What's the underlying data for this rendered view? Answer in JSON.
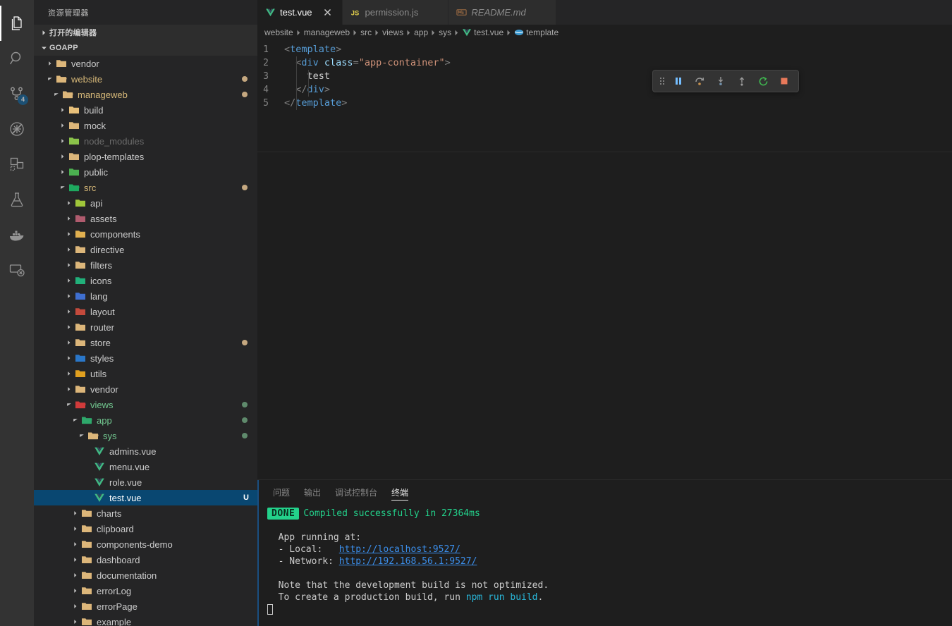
{
  "activitybar": {
    "items": [
      {
        "name": "explorer",
        "icon": "files-icon",
        "active": true,
        "badge": null
      },
      {
        "name": "search",
        "icon": "search-icon",
        "active": false,
        "badge": null
      },
      {
        "name": "source-control",
        "icon": "source-control-icon",
        "active": false,
        "badge": "4"
      },
      {
        "name": "run-debug",
        "icon": "debug-alt-icon",
        "active": false,
        "badge": null
      },
      {
        "name": "extensions",
        "icon": "extensions-icon",
        "active": false,
        "badge": null
      },
      {
        "name": "testing",
        "icon": "beaker-icon",
        "active": false,
        "badge": null
      },
      {
        "name": "docker",
        "icon": "docker-whale-icon",
        "active": false,
        "badge": null
      },
      {
        "name": "remote-explorer",
        "icon": "remote-explorer-icon",
        "active": false,
        "badge": null
      }
    ]
  },
  "sidebar": {
    "title": "资源管理器",
    "sections": [
      {
        "label": "打开的编辑器",
        "expanded": false
      },
      {
        "label": "GOAPP",
        "expanded": true
      }
    ],
    "tree": [
      {
        "label": "vendor",
        "icon": "folder",
        "indent": 1,
        "twisty": "collapsed",
        "state": "normal",
        "deco": null
      },
      {
        "label": "website",
        "icon": "folder-open",
        "indent": 1,
        "twisty": "expanded",
        "state": "modified",
        "deco": "tan"
      },
      {
        "label": "manageweb",
        "icon": "folder-open",
        "indent": 2,
        "twisty": "expanded",
        "state": "modified",
        "deco": "tan"
      },
      {
        "label": "build",
        "icon": "folder-build",
        "indent": 3,
        "twisty": "collapsed",
        "state": "normal",
        "deco": null
      },
      {
        "label": "mock",
        "icon": "folder",
        "indent": 3,
        "twisty": "collapsed",
        "state": "normal",
        "deco": null
      },
      {
        "label": "node_modules",
        "icon": "folder-node",
        "indent": 3,
        "twisty": "collapsed",
        "state": "dim",
        "deco": null
      },
      {
        "label": "plop-templates",
        "icon": "folder",
        "indent": 3,
        "twisty": "collapsed",
        "state": "normal",
        "deco": null
      },
      {
        "label": "public",
        "icon": "folder-public",
        "indent": 3,
        "twisty": "collapsed",
        "state": "normal",
        "deco": null
      },
      {
        "label": "src",
        "icon": "folder-src",
        "indent": 3,
        "twisty": "expanded",
        "state": "modified",
        "deco": "tan"
      },
      {
        "label": "api",
        "icon": "folder-api",
        "indent": 4,
        "twisty": "collapsed",
        "state": "normal",
        "deco": null
      },
      {
        "label": "assets",
        "icon": "folder-assets",
        "indent": 4,
        "twisty": "collapsed",
        "state": "normal",
        "deco": null
      },
      {
        "label": "components",
        "icon": "folder-components",
        "indent": 4,
        "twisty": "collapsed",
        "state": "normal",
        "deco": null
      },
      {
        "label": "directive",
        "icon": "folder",
        "indent": 4,
        "twisty": "collapsed",
        "state": "normal",
        "deco": null
      },
      {
        "label": "filters",
        "icon": "folder",
        "indent": 4,
        "twisty": "collapsed",
        "state": "normal",
        "deco": null
      },
      {
        "label": "icons",
        "icon": "folder-icons",
        "indent": 4,
        "twisty": "collapsed",
        "state": "normal",
        "deco": null
      },
      {
        "label": "lang",
        "icon": "folder-lang",
        "indent": 4,
        "twisty": "collapsed",
        "state": "normal",
        "deco": null
      },
      {
        "label": "layout",
        "icon": "folder-layout",
        "indent": 4,
        "twisty": "collapsed",
        "state": "normal",
        "deco": null
      },
      {
        "label": "router",
        "icon": "folder",
        "indent": 4,
        "twisty": "collapsed",
        "state": "normal",
        "deco": null
      },
      {
        "label": "store",
        "icon": "folder",
        "indent": 4,
        "twisty": "collapsed",
        "state": "normal",
        "deco": "tan"
      },
      {
        "label": "styles",
        "icon": "folder-styles",
        "indent": 4,
        "twisty": "collapsed",
        "state": "normal",
        "deco": null
      },
      {
        "label": "utils",
        "icon": "folder-utils",
        "indent": 4,
        "twisty": "collapsed",
        "state": "normal",
        "deco": null
      },
      {
        "label": "vendor",
        "icon": "folder",
        "indent": 4,
        "twisty": "collapsed",
        "state": "normal",
        "deco": null
      },
      {
        "label": "views",
        "icon": "folder-views",
        "indent": 4,
        "twisty": "expanded",
        "state": "untracked",
        "deco": "green"
      },
      {
        "label": "app",
        "icon": "folder-app",
        "indent": 5,
        "twisty": "expanded",
        "state": "untracked",
        "deco": "green"
      },
      {
        "label": "sys",
        "icon": "folder-open",
        "indent": 6,
        "twisty": "expanded",
        "state": "untracked",
        "deco": "green"
      },
      {
        "label": "admins.vue",
        "icon": "vue",
        "indent": 7,
        "twisty": "none",
        "state": "normal",
        "deco": null
      },
      {
        "label": "menu.vue",
        "icon": "vue",
        "indent": 7,
        "twisty": "none",
        "state": "normal",
        "deco": null
      },
      {
        "label": "role.vue",
        "icon": "vue",
        "indent": 7,
        "twisty": "none",
        "state": "normal",
        "deco": null
      },
      {
        "label": "test.vue",
        "icon": "vue",
        "indent": 7,
        "twisty": "none",
        "state": "selected",
        "deco": null,
        "badge": "U"
      },
      {
        "label": "charts",
        "icon": "folder",
        "indent": 5,
        "twisty": "collapsed",
        "state": "normal",
        "deco": null
      },
      {
        "label": "clipboard",
        "icon": "folder",
        "indent": 5,
        "twisty": "collapsed",
        "state": "normal",
        "deco": null
      },
      {
        "label": "components-demo",
        "icon": "folder",
        "indent": 5,
        "twisty": "collapsed",
        "state": "normal",
        "deco": null
      },
      {
        "label": "dashboard",
        "icon": "folder",
        "indent": 5,
        "twisty": "collapsed",
        "state": "normal",
        "deco": null
      },
      {
        "label": "documentation",
        "icon": "folder",
        "indent": 5,
        "twisty": "collapsed",
        "state": "normal",
        "deco": null
      },
      {
        "label": "errorLog",
        "icon": "folder",
        "indent": 5,
        "twisty": "collapsed",
        "state": "normal",
        "deco": null
      },
      {
        "label": "errorPage",
        "icon": "folder",
        "indent": 5,
        "twisty": "collapsed",
        "state": "normal",
        "deco": null
      },
      {
        "label": "example",
        "icon": "folder",
        "indent": 5,
        "twisty": "collapsed",
        "state": "normal",
        "deco": null
      }
    ]
  },
  "tabs": [
    {
      "label": "test.vue",
      "icon": "vue-icon",
      "active": true,
      "italic": false
    },
    {
      "label": "permission.js",
      "icon": "js-icon",
      "active": false,
      "italic": false
    },
    {
      "label": "README.md",
      "icon": "markdown-icon",
      "active": false,
      "italic": true
    }
  ],
  "breadcrumb": [
    {
      "label": "website",
      "icon": null
    },
    {
      "label": "manageweb",
      "icon": null
    },
    {
      "label": "src",
      "icon": null
    },
    {
      "label": "views",
      "icon": null
    },
    {
      "label": "app",
      "icon": null
    },
    {
      "label": "sys",
      "icon": null
    },
    {
      "label": "test.vue",
      "icon": "vue-icon"
    },
    {
      "label": "template",
      "icon": "symbol-icon"
    }
  ],
  "editor": {
    "lines": [
      {
        "num": "1",
        "tokens": [
          {
            "t": "<",
            "c": "tok-punct"
          },
          {
            "t": "template",
            "c": "tok-tag"
          },
          {
            "t": ">",
            "c": "tok-punct"
          }
        ],
        "indent": 0
      },
      {
        "num": "2",
        "tokens": [
          {
            "t": "  <",
            "c": "tok-punct"
          },
          {
            "t": "div",
            "c": "tok-tag"
          },
          {
            "t": " ",
            "c": "tok-txt"
          },
          {
            "t": "class",
            "c": "tok-attr"
          },
          {
            "t": "=",
            "c": "tok-punct"
          },
          {
            "t": "\"app-container\"",
            "c": "tok-str"
          },
          {
            "t": ">",
            "c": "tok-punct"
          }
        ],
        "indent": 0
      },
      {
        "num": "3",
        "tokens": [
          {
            "t": "    test",
            "c": "tok-txt"
          }
        ],
        "indent": 1
      },
      {
        "num": "4",
        "tokens": [
          {
            "t": "  </",
            "c": "tok-punct"
          },
          {
            "t": "div",
            "c": "tok-tag"
          },
          {
            "t": ">",
            "c": "tok-punct"
          }
        ],
        "indent": 0
      },
      {
        "num": "5",
        "tokens": [
          {
            "t": "</",
            "c": "tok-punct"
          },
          {
            "t": "template",
            "c": "tok-tag"
          },
          {
            "t": ">",
            "c": "tok-punct"
          }
        ],
        "indent": 0
      }
    ]
  },
  "debug_toolbar": {
    "buttons": [
      {
        "name": "drag-handle-icon",
        "label": "drag"
      },
      {
        "name": "pause-icon",
        "label": "Pause"
      },
      {
        "name": "step-over-icon",
        "label": "Step Over"
      },
      {
        "name": "step-into-icon",
        "label": "Step Into"
      },
      {
        "name": "step-out-icon",
        "label": "Step Out"
      },
      {
        "name": "restart-icon",
        "label": "Restart"
      },
      {
        "name": "stop-icon",
        "label": "Stop"
      }
    ]
  },
  "panel": {
    "tabs": [
      {
        "label": "问题",
        "active": false
      },
      {
        "label": "输出",
        "active": false
      },
      {
        "label": "调试控制台",
        "active": false
      },
      {
        "label": "终端",
        "active": true
      }
    ],
    "terminal": {
      "status_badge": "DONE",
      "status_text": "Compiled successfully in 27364ms",
      "lines": [
        {
          "type": "blank",
          "text": ""
        },
        {
          "type": "plain",
          "text": "  App running at:"
        },
        {
          "type": "link",
          "prefix": "  - Local:   ",
          "link": "http://localhost:9527/"
        },
        {
          "type": "link",
          "prefix": "  - Network: ",
          "link": "http://192.168.56.1:9527/"
        },
        {
          "type": "blank",
          "text": ""
        },
        {
          "type": "plain",
          "text": "  Note that the development build is not optimized."
        },
        {
          "type": "cmd",
          "prefix": "  To create a production build, run ",
          "cmd": "npm run build",
          "suffix": "."
        }
      ]
    }
  },
  "colors": {
    "accent_blue": "#094771",
    "badge_blue": "#0e639c",
    "green_untracked": "#73c991",
    "tan_modified": "#d6b878",
    "terminal_green": "#23d18b",
    "link_blue": "#3b8eea",
    "editor_bg": "#1e1e1e",
    "sidebar_bg": "#252526",
    "activitybar_bg": "#333333"
  }
}
